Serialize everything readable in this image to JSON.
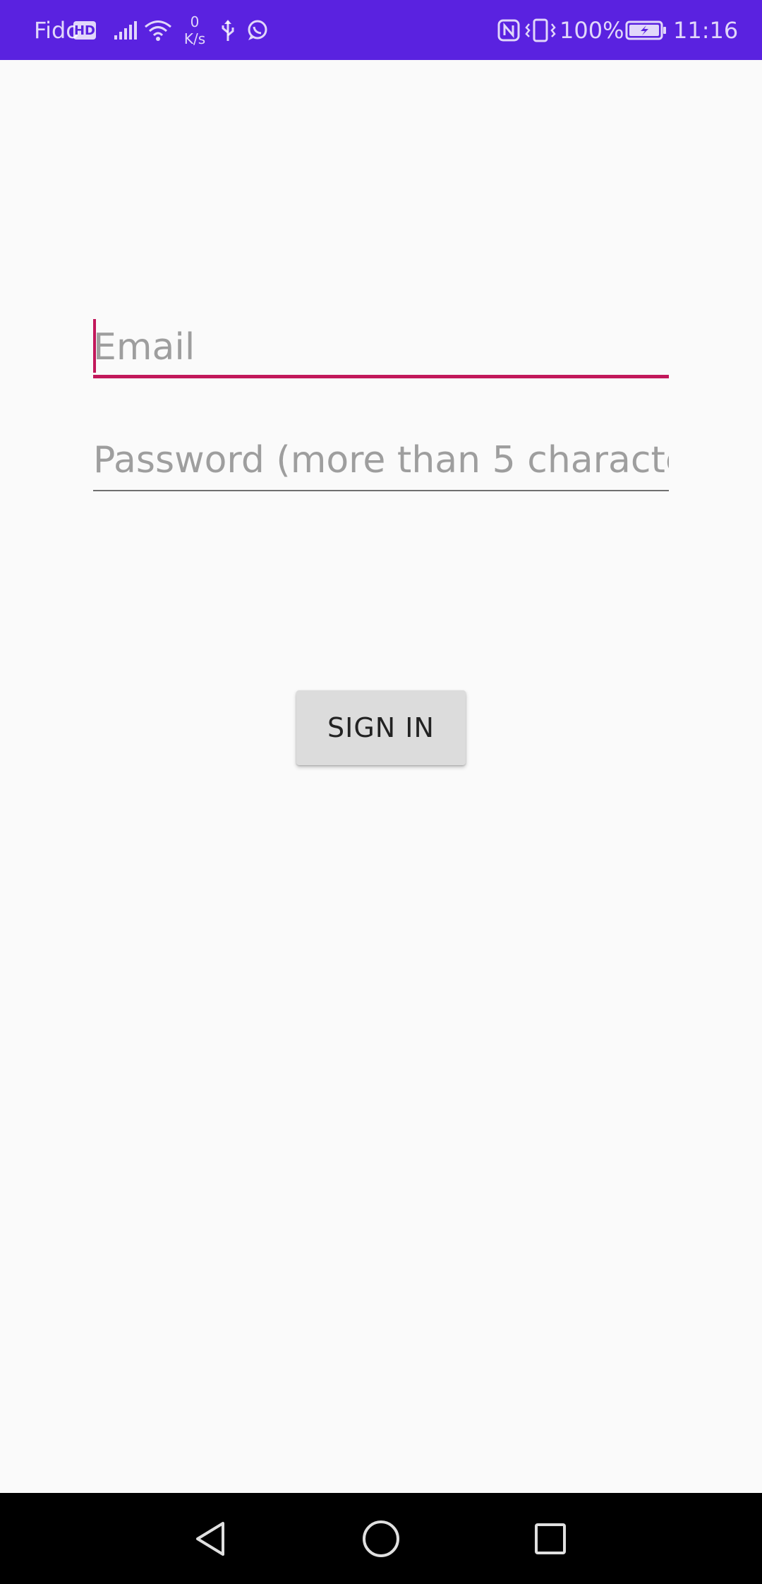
{
  "status_bar": {
    "carrier": "Fido",
    "hd_badge": "HD",
    "net_speed_value": "0",
    "net_speed_unit": "K/s",
    "battery_percent": "100%",
    "time": "11:16",
    "bar_color": "#5a22e0"
  },
  "login_form": {
    "email_placeholder": "Email",
    "password_placeholder": "Password (more than 5 characte",
    "sign_in_label": "SIGN IN",
    "accent_color": "#c2185b"
  },
  "nav_bar": {
    "icons": [
      "back-icon",
      "home-icon",
      "recent-apps-icon"
    ]
  }
}
